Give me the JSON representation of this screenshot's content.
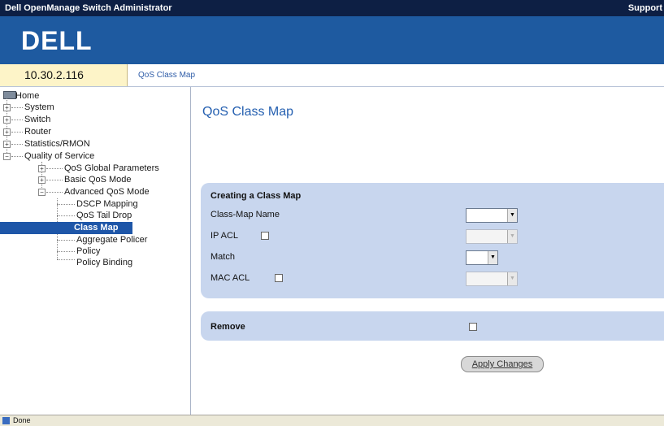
{
  "window": {
    "title": "Dell OpenManage Switch Administrator",
    "support_link": "Support"
  },
  "header": {
    "logo": "DELL"
  },
  "info": {
    "ip": "10.30.2.116",
    "breadcrumb": "QoS Class Map"
  },
  "tree": {
    "home": "Home",
    "system": "System",
    "switch": "Switch",
    "router": "Router",
    "stats": "Statistics/RMON",
    "qos": "Quality of Service",
    "qos_global": "QoS Global Parameters",
    "basic_qos": "Basic QoS Mode",
    "advanced_qos": "Advanced QoS Mode",
    "dscp": "DSCP Mapping",
    "tail_drop": "QoS Tail Drop",
    "class_map": "Class Map",
    "aggregate": "Aggregate Policer",
    "policy": "Policy",
    "policy_binding": "Policy Binding"
  },
  "main": {
    "title": "QoS Class Map",
    "panel_title": "Creating a Class Map",
    "class_map_name_label": "Class-Map Name",
    "ip_acl_label": "IP ACL",
    "match_label": "Match",
    "mac_acl_label": "MAC ACL",
    "remove_label": "Remove",
    "apply_label": "Apply Changes"
  },
  "status": {
    "text": "Done"
  }
}
